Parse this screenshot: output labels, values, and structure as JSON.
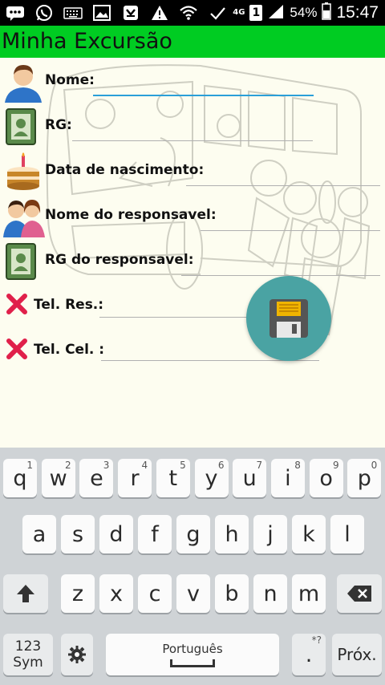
{
  "status_bar": {
    "network": "4G",
    "sim": "1",
    "battery": "54%",
    "time": "15:47"
  },
  "app": {
    "title": "Minha Excursão"
  },
  "form": {
    "nome_label": "Nome:",
    "rg_label": "RG:",
    "nascimento_label": "Data de nascimento:",
    "responsavel_label": "Nome do responsavel:",
    "rg_responsavel_label": "RG do responsavel:",
    "tel_res_label": "Tel. Res.:",
    "tel_cel_label": "Tel. Cel. :"
  },
  "keyboard": {
    "row1": [
      {
        "key": "q",
        "hint": "1"
      },
      {
        "key": "w",
        "hint": "2"
      },
      {
        "key": "e",
        "hint": "3"
      },
      {
        "key": "r",
        "hint": "4"
      },
      {
        "key": "t",
        "hint": "5"
      },
      {
        "key": "y",
        "hint": "6"
      },
      {
        "key": "u",
        "hint": "7"
      },
      {
        "key": "i",
        "hint": "8"
      },
      {
        "key": "o",
        "hint": "9"
      },
      {
        "key": "p",
        "hint": "0"
      }
    ],
    "row2": [
      "a",
      "s",
      "d",
      "f",
      "g",
      "h",
      "j",
      "k",
      "l"
    ],
    "row3": [
      "z",
      "x",
      "c",
      "v",
      "b",
      "n",
      "m"
    ],
    "sym_label": "123\nSym",
    "space_label": "Português",
    "period": ".",
    "period_hint": "*?",
    "next_label": "Próx."
  },
  "colors": {
    "title_bar": "#00cc22",
    "fab": "#4aa3a3",
    "active_underline": "#2a9fd8",
    "delete_x": "#e0204a"
  }
}
